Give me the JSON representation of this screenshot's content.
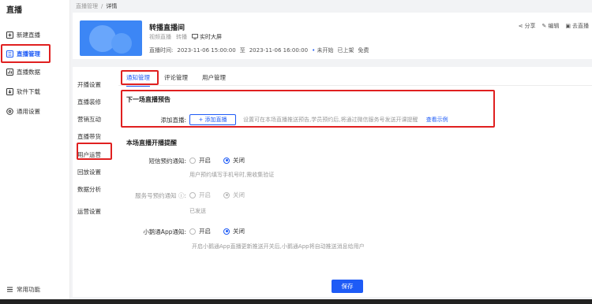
{
  "sidebar": {
    "title": "直播",
    "items": [
      {
        "label": "新建直播",
        "icon": "plus-square-icon"
      },
      {
        "label": "直播管理",
        "icon": "list-icon"
      },
      {
        "label": "直播数据",
        "icon": "chart-icon"
      },
      {
        "label": "软件下载",
        "icon": "download-icon"
      },
      {
        "label": "通用设置",
        "icon": "gear-icon"
      }
    ],
    "footer_label": "常用功能"
  },
  "breadcrumb": {
    "parent": "直播管理",
    "sep": "/",
    "current": "详情"
  },
  "live": {
    "title": "转播直播间",
    "category": "视频直播",
    "relay": "转播",
    "screen": "实时大屏",
    "time_label": "直播时间:",
    "start": "2023-11-06 15:00:00",
    "to": "至",
    "end": "2023-11-06 16:00:00",
    "status": "未开始",
    "listed": "已上架",
    "price": "免费"
  },
  "actions": {
    "share": "分享",
    "edit": "编辑",
    "go_live": "去直播"
  },
  "sub_nav": [
    "开播设置",
    "直播装修",
    "营销互动",
    "直播带货",
    "用户运营",
    "回放设置",
    "数据分析",
    "运营设置"
  ],
  "tabs": [
    "通知管理",
    "评论管理",
    "用户管理"
  ],
  "preview": {
    "title": "下一场直播预告",
    "add_label": "添加直播:",
    "add_button": "+ 添加直播",
    "hint": "设置可在本场直播推送预告,学员预约后,将通过微信服务号发送开课提醒",
    "link": "查看示例"
  },
  "reminder": {
    "title": "本场直播开播提醒",
    "sms": {
      "label": "短信预约通知:",
      "on": "开启",
      "off": "关闭",
      "selected": "关闭",
      "hint": "用户预约填写手机号时,需收集验证"
    },
    "wechat": {
      "label": "服务号预约通知 ⓘ:",
      "on": "开启",
      "off": "关闭",
      "selected": "关闭",
      "hint": "已发送"
    },
    "xiaoe": {
      "label": "小鹅通App通知:",
      "on": "开启",
      "off": "关闭",
      "selected": "关闭",
      "hint": "开启小鹅通App直播更新推送开关后,小鹅通App将自动推送消息给用户"
    }
  },
  "save_label": "保存",
  "colors": {
    "accent": "#1e5bf6",
    "highlight_box": "#e02020"
  }
}
